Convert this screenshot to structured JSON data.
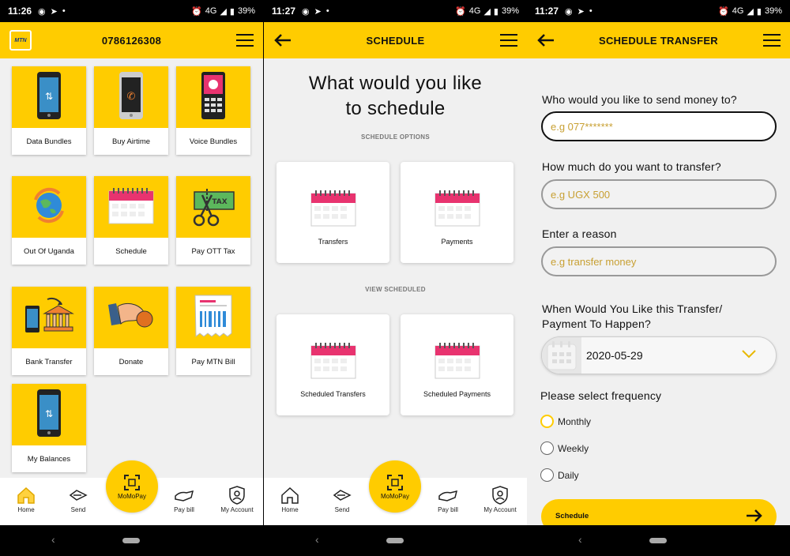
{
  "colors": {
    "brand_yellow": "#ffcc00",
    "calendar_pink": "#e8336f",
    "placeholder_gold": "#c8a033"
  },
  "status": {
    "s1": {
      "time": "11:26",
      "battery": "39%",
      "network": "4G"
    },
    "s2": {
      "time": "11:27",
      "battery": "39%",
      "network": "4G"
    },
    "s3": {
      "time": "11:27",
      "battery": "39%",
      "network": "4G"
    }
  },
  "home": {
    "phone_number": "0786126308",
    "logo_text": "MTN",
    "tiles": [
      {
        "label": "Data Bundles",
        "icon": "phone-data-icon"
      },
      {
        "label": "Buy Airtime",
        "icon": "phone-call-icon"
      },
      {
        "label": "Voice Bundles",
        "icon": "feature-phone-icon"
      },
      {
        "label": "Out Of Uganda",
        "icon": "globe-exchange-icon"
      },
      {
        "label": "Schedule",
        "icon": "calendar-icon"
      },
      {
        "label": "Pay OTT Tax",
        "icon": "tax-scissors-icon"
      },
      {
        "label": "Bank Transfer",
        "icon": "bank-transfer-icon"
      },
      {
        "label": "Donate",
        "icon": "donate-hand-icon"
      },
      {
        "label": "Pay MTN Bill",
        "icon": "bill-receipt-icon"
      },
      {
        "label": "My Balances",
        "icon": "phone-balance-icon"
      }
    ]
  },
  "bottom_nav": {
    "home": "Home",
    "send": "Send",
    "momopay": "MoMoPay",
    "paybill": "Pay bill",
    "account": "My Account"
  },
  "schedule": {
    "title": "SCHEDULE",
    "heading_line1": "What would you like",
    "heading_line2": "to schedule",
    "options_label": "SCHEDULE OPTIONS",
    "view_label": "VIEW SCHEDULED",
    "cards": [
      "Transfers",
      "Payments",
      "Scheduled Transfers",
      "Scheduled Payments"
    ]
  },
  "transfer": {
    "title": "SCHEDULE TRANSFER",
    "q_recipient": "Who would you like to send money to?",
    "recipient_placeholder": "e.g 077*******",
    "q_amount": "How much do you want to transfer?",
    "amount_placeholder": "e.g UGX 500",
    "q_reason": "Enter a reason",
    "reason_placeholder": "e.g transfer money",
    "q_when_line1": "When Would You Like this Transfer/",
    "q_when_line2": "Payment To Happen?",
    "date": "2020-05-29",
    "q_frequency": "Please select frequency",
    "frequencies": [
      "Monthly",
      "Weekly",
      "Daily"
    ],
    "selected_frequency": "Monthly",
    "submit_label": "Schedule"
  }
}
